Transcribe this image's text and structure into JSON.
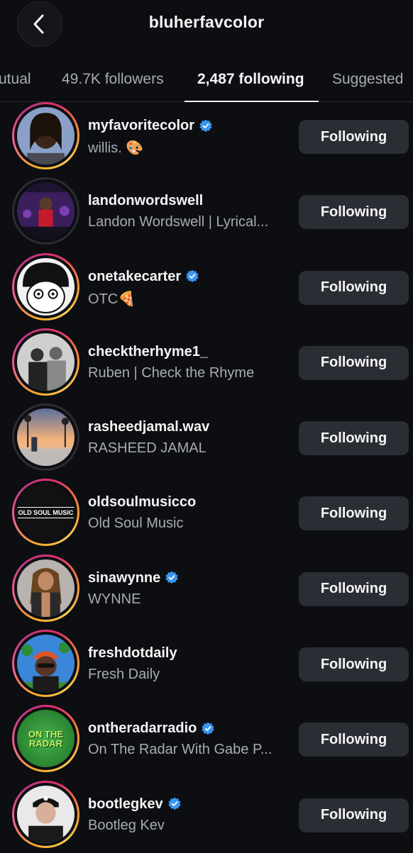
{
  "header": {
    "title": "bluherfavcolor"
  },
  "tabs": [
    {
      "label": "utual",
      "active": false
    },
    {
      "label": "49.7K followers",
      "active": false
    },
    {
      "label": "2,487 following",
      "active": true
    },
    {
      "label": "Suggested",
      "active": false
    }
  ],
  "accounts": [
    {
      "username": "myfavoritecolor",
      "verified": true,
      "fullname": "willis. 🎨",
      "button": "Following",
      "ring": "story"
    },
    {
      "username": "landonwordswell",
      "verified": false,
      "fullname": "Landon Wordswell | Lyrical...",
      "button": "Following",
      "ring": "none"
    },
    {
      "username": "onetakecarter",
      "verified": true,
      "fullname": "OTC🍕",
      "button": "Following",
      "ring": "story"
    },
    {
      "username": "checktherhyme1_",
      "verified": false,
      "fullname": "Ruben | Check the Rhyme",
      "button": "Following",
      "ring": "story"
    },
    {
      "username": "rasheedjamal.wav",
      "verified": false,
      "fullname": "RASHEED JAMAL",
      "button": "Following",
      "ring": "none"
    },
    {
      "username": "oldsoulmusicco",
      "verified": false,
      "fullname": "Old Soul Music",
      "button": "Following",
      "ring": "story",
      "avatar_text": "OLD SOUL MUSIC"
    },
    {
      "username": "sinawynne",
      "verified": true,
      "fullname": "WYNNE",
      "button": "Following",
      "ring": "story"
    },
    {
      "username": "freshdotdaily",
      "verified": false,
      "fullname": "Fresh Daily",
      "button": "Following",
      "ring": "story"
    },
    {
      "username": "ontheradarradio",
      "verified": true,
      "fullname": "On The Radar With Gabe P...",
      "button": "Following",
      "ring": "story",
      "avatar_text": "ON THE RADAR"
    },
    {
      "username": "bootlegkev",
      "verified": true,
      "fullname": "Bootleg Kev",
      "button": "Following",
      "ring": "story"
    }
  ],
  "colors": {
    "background": "#0c0e12",
    "verified": "#3897f0",
    "button_bg": "#2a2d33",
    "secondary_text": "#a8abb1"
  }
}
